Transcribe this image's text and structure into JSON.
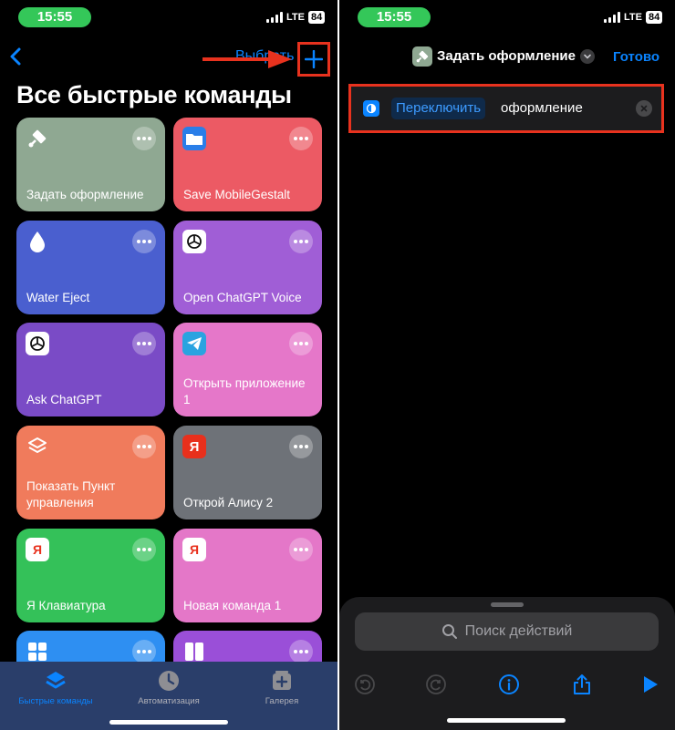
{
  "left": {
    "status": {
      "time": "15:55",
      "network": "LTE",
      "battery": "84"
    },
    "header": {
      "select_label": "Выбрать"
    },
    "title": "Все быстрые команды",
    "tiles": [
      {
        "label": "Задать оформление",
        "color": "#8fa892",
        "icon": "paintbrush-icon"
      },
      {
        "label": "Save MobileGestalt",
        "color": "#ec5a64",
        "icon": "folder-icon"
      },
      {
        "label": "Water Eject",
        "color": "#4a5fcf",
        "icon": "droplet-icon"
      },
      {
        "label": "Open ChatGPT Voice",
        "color": "#a05ed6",
        "icon": "chatgpt-icon"
      },
      {
        "label": "Ask ChatGPT",
        "color": "#7a4bc6",
        "icon": "chatgpt-icon"
      },
      {
        "label": "Открыть приложение 1",
        "color": "#e577c9",
        "icon": "telegram-icon"
      },
      {
        "label": "Показать Пункт управления",
        "color": "#f07b5c",
        "icon": "layers-icon"
      },
      {
        "label": "Открой Алису 2",
        "color": "#6e7278",
        "icon": "yandex-icon"
      },
      {
        "label": "Я Клавиатура",
        "color": "#34c159",
        "icon": "yandex-icon"
      },
      {
        "label": "Новая команда 1",
        "color": "#e477c8",
        "icon": "yandex-icon"
      },
      {
        "label": "",
        "color": "#2e8ff2",
        "icon": "grid-icon"
      },
      {
        "label": "",
        "color": "#9a4fd8",
        "icon": "split-icon"
      }
    ],
    "tabs": [
      {
        "label": "Быстрые команды",
        "icon": "layers-icon",
        "active": true
      },
      {
        "label": "Автоматизация",
        "icon": "clock-icon",
        "active": false
      },
      {
        "label": "Галерея",
        "icon": "gallery-icon",
        "active": false
      }
    ]
  },
  "right": {
    "status": {
      "time": "15:55",
      "network": "LTE",
      "battery": "84"
    },
    "header": {
      "title": "Задать оформление",
      "done_label": "Готово"
    },
    "action": {
      "param": "Переключить",
      "text": "оформление"
    },
    "search": {
      "placeholder": "Поиск действий"
    }
  },
  "colors": {
    "accent": "#0a84ff",
    "highlight": "#e8321e",
    "status_pill": "#34c759"
  }
}
